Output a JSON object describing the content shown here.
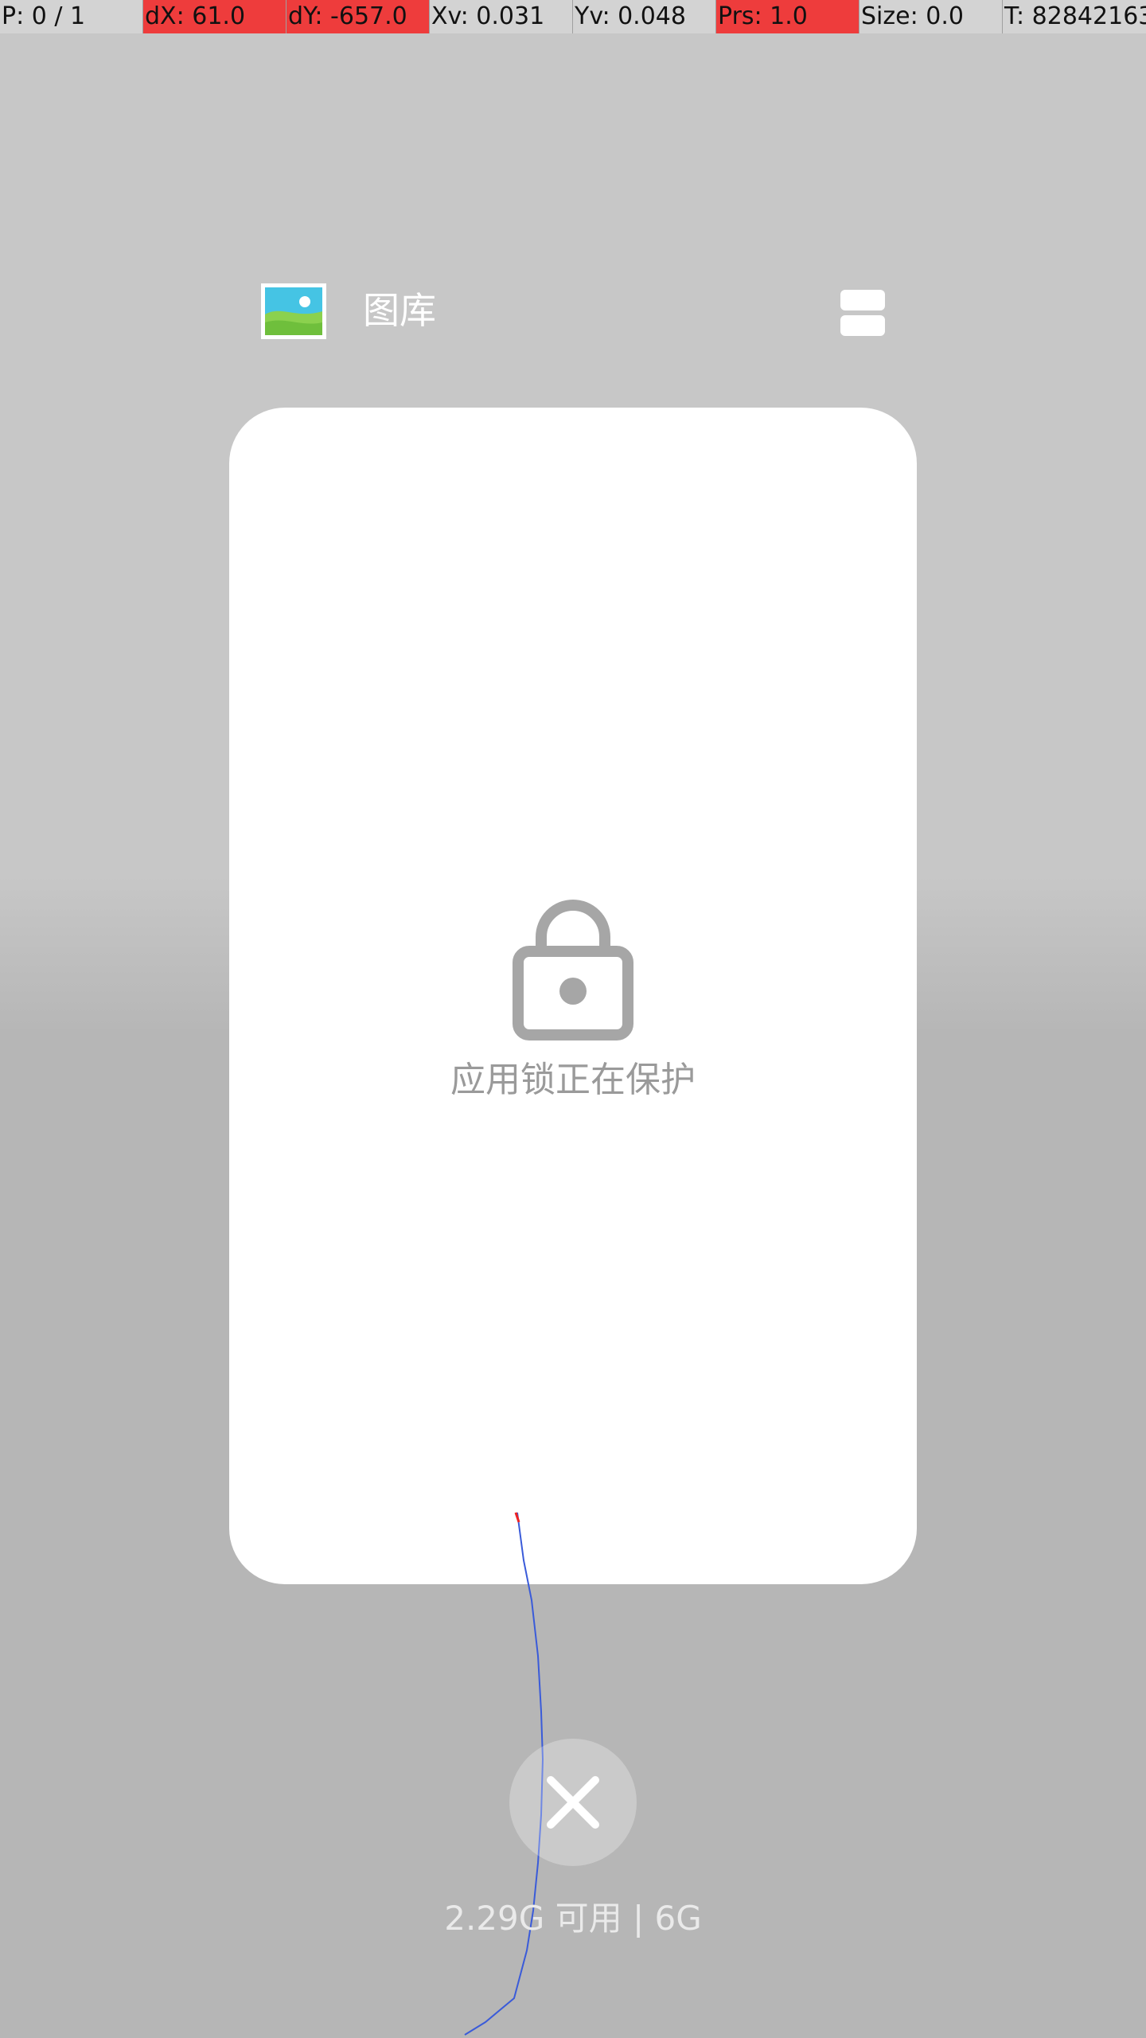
{
  "debug_bar": {
    "cells": [
      {
        "text": "P: 0 / 1",
        "highlight": false
      },
      {
        "text": "dX: 61.0",
        "highlight": true
      },
      {
        "text": "dY: -657.0",
        "highlight": true
      },
      {
        "text": "Xv: 0.031",
        "highlight": false
      },
      {
        "text": "Yv: 0.048",
        "highlight": false
      },
      {
        "text": "Prs: 1.0",
        "highlight": true
      },
      {
        "text": "Size: 0.0",
        "highlight": false
      },
      {
        "text": "T: 82842163",
        "highlight": false
      }
    ],
    "highlight_color": "#ee3c3c"
  },
  "app": {
    "title": "图库",
    "icon": "gallery-icon",
    "split_icon": "split-screen-icon"
  },
  "card": {
    "lock_icon": "lock-icon",
    "lock_message": "应用锁正在保护"
  },
  "clear_button": {
    "icon": "close-icon"
  },
  "memory": {
    "text": "2.29G 可用 | 6G"
  },
  "colors": {
    "background": "#c7c7c7",
    "card": "#ffffff",
    "lock": "#a6a6a6",
    "trail": "#3a5bd9"
  }
}
